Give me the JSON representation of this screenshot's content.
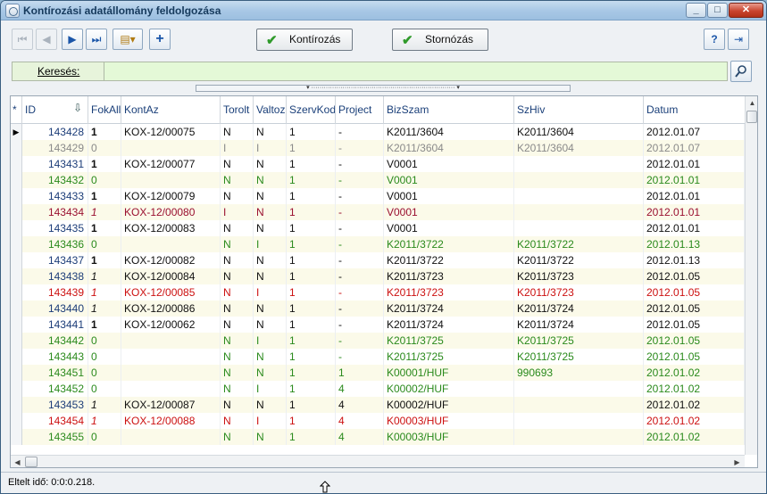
{
  "window": {
    "title": "Kontírozási adatállomány feldolgozása",
    "minimize_glyph": "_",
    "maximize_glyph": "□",
    "close_glyph": "✕"
  },
  "toolbar": {
    "first_icon": "first-record-icon",
    "prev_icon": "prev-record-icon",
    "next_icon": "next-record-icon",
    "last_icon": "last-record-icon",
    "export_icon": "export-dropdown-icon",
    "add_icon": "add-icon",
    "kontirozas_label": "Kontírozás",
    "stornozas_label": "Stornózás",
    "help_icon": "help-icon",
    "exit_icon": "exit-door-icon"
  },
  "search": {
    "label": "Keresés:",
    "value": "",
    "placeholder": ""
  },
  "grid": {
    "columns": [
      "*",
      "ID",
      "FokAll",
      "KontAz",
      "Torolt",
      "Valtoz",
      "SzervKod",
      "Project",
      "BizSzam",
      "SzHiv",
      "Datum"
    ],
    "rows": [
      {
        "ID": "143428",
        "FokAll": "1",
        "KontAz": "KOX-12/00075",
        "Torolt": "N",
        "Valtoz": "N",
        "SzervKod": "1",
        "Project": "-",
        "BizSzam": "K2011/3604",
        "SzHiv": "K2011/3604",
        "Datum": "2012.01.07",
        "style": "dark",
        "current": true
      },
      {
        "ID": "143429",
        "FokAll": "0",
        "KontAz": "",
        "Torolt": "I",
        "Valtoz": "I",
        "SzervKod": "1",
        "Project": "-",
        "BizSzam": "K2011/3604",
        "SzHiv": "K2011/3604",
        "Datum": "2012.01.07",
        "style": "gray"
      },
      {
        "ID": "143431",
        "FokAll": "1",
        "KontAz": "KOX-12/00077",
        "Torolt": "N",
        "Valtoz": "N",
        "SzervKod": "1",
        "Project": "-",
        "BizSzam": "V0001",
        "SzHiv": "",
        "Datum": "2012.01.01",
        "style": "dark"
      },
      {
        "ID": "143432",
        "FokAll": "0",
        "KontAz": "",
        "Torolt": "N",
        "Valtoz": "N",
        "SzervKod": "1",
        "Project": "-",
        "BizSzam": "V0001",
        "SzHiv": "",
        "Datum": "2012.01.01",
        "style": "green"
      },
      {
        "ID": "143433",
        "FokAll": "1",
        "KontAz": "KOX-12/00079",
        "Torolt": "N",
        "Valtoz": "N",
        "SzervKod": "1",
        "Project": "-",
        "BizSzam": "V0001",
        "SzHiv": "",
        "Datum": "2012.01.01",
        "style": "dark"
      },
      {
        "ID": "143434",
        "FokAll": "1",
        "KontAz": "KOX-12/00080",
        "Torolt": "I",
        "Valtoz": "N",
        "SzervKod": "1",
        "Project": "-",
        "BizSzam": "V0001",
        "SzHiv": "",
        "Datum": "2012.01.01",
        "style": "maroon"
      },
      {
        "ID": "143435",
        "FokAll": "1",
        "KontAz": "KOX-12/00083",
        "Torolt": "N",
        "Valtoz": "N",
        "SzervKod": "1",
        "Project": "-",
        "BizSzam": "V0001",
        "SzHiv": "",
        "Datum": "2012.01.01",
        "style": "dark"
      },
      {
        "ID": "143436",
        "FokAll": "0",
        "KontAz": "",
        "Torolt": "N",
        "Valtoz": "I",
        "SzervKod": "1",
        "Project": "-",
        "BizSzam": "K2011/3722",
        "SzHiv": "K2011/3722",
        "Datum": "2012.01.13",
        "style": "green"
      },
      {
        "ID": "143437",
        "FokAll": "1",
        "KontAz": "KOX-12/00082",
        "Torolt": "N",
        "Valtoz": "N",
        "SzervKod": "1",
        "Project": "-",
        "BizSzam": "K2011/3722",
        "SzHiv": "K2011/3722",
        "Datum": "2012.01.13",
        "style": "dark"
      },
      {
        "ID": "143438",
        "FokAll": "1",
        "KontAz": "KOX-12/00084",
        "Torolt": "N",
        "Valtoz": "N",
        "SzervKod": "1",
        "Project": "-",
        "BizSzam": "K2011/3723",
        "SzHiv": "K2011/3723",
        "Datum": "2012.01.05",
        "style": "dark"
      },
      {
        "ID": "143439",
        "FokAll": "1",
        "KontAz": "KOX-12/00085",
        "Torolt": "N",
        "Valtoz": "I",
        "SzervKod": "1",
        "Project": "-",
        "BizSzam": "K2011/3723",
        "SzHiv": "K2011/3723",
        "Datum": "2012.01.05",
        "style": "red"
      },
      {
        "ID": "143440",
        "FokAll": "1",
        "KontAz": "KOX-12/00086",
        "Torolt": "N",
        "Valtoz": "N",
        "SzervKod": "1",
        "Project": "-",
        "BizSzam": "K2011/3724",
        "SzHiv": "K2011/3724",
        "Datum": "2012.01.05",
        "style": "dark"
      },
      {
        "ID": "143441",
        "FokAll": "1",
        "KontAz": "KOX-12/00062",
        "Torolt": "N",
        "Valtoz": "N",
        "SzervKod": "1",
        "Project": "-",
        "BizSzam": "K2011/3724",
        "SzHiv": "K2011/3724",
        "Datum": "2012.01.05",
        "style": "dark"
      },
      {
        "ID": "143442",
        "FokAll": "0",
        "KontAz": "",
        "Torolt": "N",
        "Valtoz": "I",
        "SzervKod": "1",
        "Project": "-",
        "BizSzam": "K2011/3725",
        "SzHiv": "K2011/3725",
        "Datum": "2012.01.05",
        "style": "green"
      },
      {
        "ID": "143443",
        "FokAll": "0",
        "KontAz": "",
        "Torolt": "N",
        "Valtoz": "N",
        "SzervKod": "1",
        "Project": "-",
        "BizSzam": "K2011/3725",
        "SzHiv": "K2011/3725",
        "Datum": "2012.01.05",
        "style": "green"
      },
      {
        "ID": "143451",
        "FokAll": "0",
        "KontAz": "",
        "Torolt": "N",
        "Valtoz": "N",
        "SzervKod": "1",
        "Project": "1",
        "BizSzam": "K00001/HUF",
        "SzHiv": "990693",
        "Datum": "2012.01.02",
        "style": "green"
      },
      {
        "ID": "143452",
        "FokAll": "0",
        "KontAz": "",
        "Torolt": "N",
        "Valtoz": "I",
        "SzervKod": "1",
        "Project": "4",
        "BizSzam": "K00002/HUF",
        "SzHiv": "",
        "Datum": "2012.01.02",
        "style": "green"
      },
      {
        "ID": "143453",
        "FokAll": "1",
        "KontAz": "KOX-12/00087",
        "Torolt": "N",
        "Valtoz": "N",
        "SzervKod": "1",
        "Project": "4",
        "BizSzam": "K00002/HUF",
        "SzHiv": "",
        "Datum": "2012.01.02",
        "style": "dark"
      },
      {
        "ID": "143454",
        "FokAll": "1",
        "KontAz": "KOX-12/00088",
        "Torolt": "N",
        "Valtoz": "I",
        "SzervKod": "1",
        "Project": "4",
        "BizSzam": "K00003/HUF",
        "SzHiv": "",
        "Datum": "2012.01.02",
        "style": "red"
      },
      {
        "ID": "143455",
        "FokAll": "0",
        "KontAz": "",
        "Torolt": "N",
        "Valtoz": "N",
        "SzervKod": "1",
        "Project": "4",
        "BizSzam": "K00003/HUF",
        "SzHiv": "",
        "Datum": "2012.01.02",
        "style": "green"
      }
    ]
  },
  "status": {
    "elapsed": "Eltelt idő: 0:0:0.218."
  },
  "colors": {
    "dark": "#111111",
    "gray": "#8a8a8a",
    "green": "#2a8a1c",
    "red": "#cc1010",
    "maroon": "#9a1030",
    "header_text": "#1a3f79",
    "search_bg": "#e4f9d7"
  }
}
